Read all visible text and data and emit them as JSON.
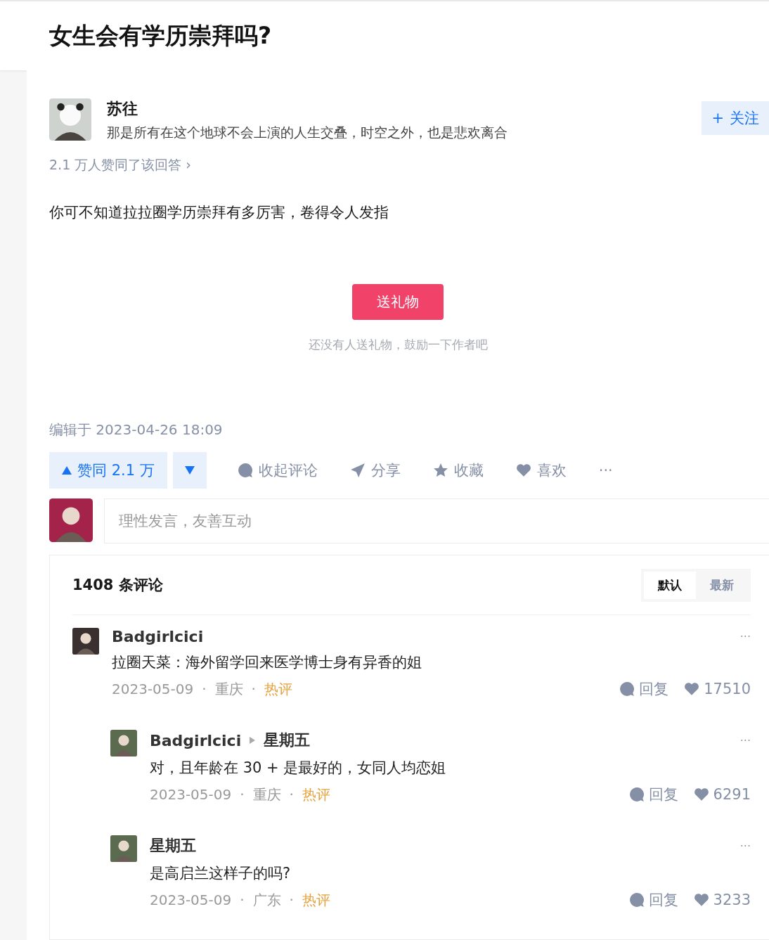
{
  "question": {
    "title": "女生会有学历崇拜吗?"
  },
  "answer": {
    "author": {
      "name": "苏往",
      "bio": "那是所有在这个地球不会上演的人生交叠，时空之外，也是悲欢离合"
    },
    "follow_button": {
      "icon": "+",
      "label": "关注"
    },
    "upvote_summary": "2.1 万人赞同了该回答 ›",
    "content": "你可不知道拉拉圈学历崇拜有多厉害，卷得令人发指",
    "gift_button": "送礼物",
    "gift_hint": "还没有人送礼物，鼓励一下作者吧",
    "edited": "编辑于 2023-04-26 18:09",
    "actions": {
      "upvote": "赞同 2.1 万",
      "items": [
        {
          "kind": "comment",
          "label": "收起评论"
        },
        {
          "kind": "share",
          "label": "分享"
        },
        {
          "kind": "star",
          "label": "收藏"
        },
        {
          "kind": "heart",
          "label": "喜欢"
        },
        {
          "kind": "more",
          "label": "···"
        }
      ]
    }
  },
  "comment_input": {
    "placeholder": "理性发言，友善互动"
  },
  "comments": {
    "count": "1408 条评论",
    "sort_tabs": [
      {
        "label": "默认",
        "selected": true
      },
      {
        "label": "最新",
        "selected": false
      }
    ],
    "items": [
      {
        "author": "Badgirlcici",
        "separator": "·",
        "text": "拉圈天菜：海外留学回来医学博士身有异香的姐",
        "date": "2023-05-09",
        "location": "重庆",
        "tag": "热评",
        "reply": "回复",
        "likes": "17510",
        "more": "···",
        "children": [
          {
            "author": "Badgirlcici",
            "separator": "·",
            "reply_to": "星期五",
            "text": "对，且年龄在 30 + 是最好的，女同人均恋姐",
            "date": "2023-05-09",
            "location": "重庆",
            "tag": "热评",
            "reply": "回复",
            "likes": "6291",
            "more": "···"
          },
          {
            "author": "星期五",
            "separator": "·",
            "text": "是高启兰这样子的吗?",
            "date": "2023-05-09",
            "location": "广东",
            "tag": "热评",
            "reply": "回复",
            "likes": "3233",
            "more": "···"
          }
        ]
      }
    ]
  }
}
